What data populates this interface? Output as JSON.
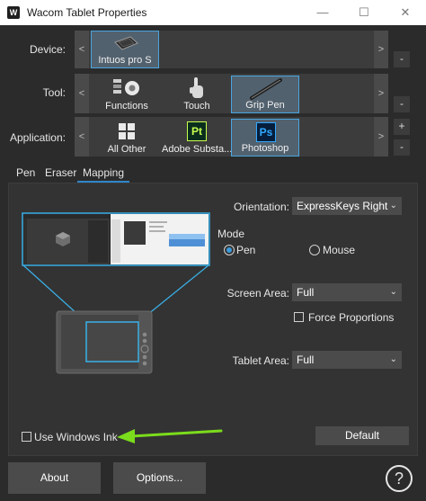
{
  "window": {
    "title": "Wacom Tablet Properties",
    "logo_glyph": "W",
    "minimize_glyph": "—",
    "maximize_glyph": "☐",
    "close_glyph": "✕"
  },
  "device_row": {
    "label": "Device:",
    "left_arrow": "<",
    "right_arrow": ">",
    "items": [
      {
        "label": "Intuos pro S",
        "selected": true,
        "icon": "tablet-icon"
      }
    ],
    "side_minus": "-"
  },
  "tool_row": {
    "label": "Tool:",
    "left_arrow": "<",
    "right_arrow": ">",
    "items": [
      {
        "label": "Functions",
        "icon": "functions-icon"
      },
      {
        "label": "Touch",
        "icon": "touch-hand-icon"
      },
      {
        "label": "Grip Pen",
        "icon": "pen-icon",
        "selected": true
      }
    ],
    "side_minus": "-"
  },
  "application_row": {
    "label": "Application:",
    "left_arrow": "<",
    "right_arrow": ">",
    "items": [
      {
        "label": "All Other",
        "icon": "all-apps-icon"
      },
      {
        "label": "Adobe Substa...",
        "icon_text": "Pt",
        "color": "#0a2e1e",
        "text_color": "#c8ff4e"
      },
      {
        "label": "Photoshop",
        "icon_text": "Ps",
        "color": "#061e3c",
        "text_color": "#31a8ff",
        "selected": true
      }
    ],
    "side_plus": "+",
    "side_minus": "-"
  },
  "tabs": [
    "Pen",
    "Eraser",
    "Mapping"
  ],
  "mapping": {
    "orientation_label": "Orientation:",
    "orientation_value": "ExpressKeys Right",
    "mode_label": "Mode",
    "mode_pen": "Pen",
    "mode_mouse": "Mouse",
    "mode_selected": "pen",
    "screen_area_label": "Screen Area:",
    "screen_area_value": "Full",
    "force_proportions_label": "Force Proportions",
    "force_proportions_checked": false,
    "tablet_area_label": "Tablet Area:",
    "tablet_area_value": "Full",
    "use_windows_ink_label": "Use Windows Ink",
    "use_windows_ink_checked": false,
    "default_button": "Default",
    "annotation_arrow_color": "#7bdc1c"
  },
  "footer": {
    "about_button": "About",
    "options_button": "Options...",
    "help_glyph": "?"
  },
  "colors": {
    "accent": "#4aa6e0",
    "background": "#2b2b2b"
  }
}
